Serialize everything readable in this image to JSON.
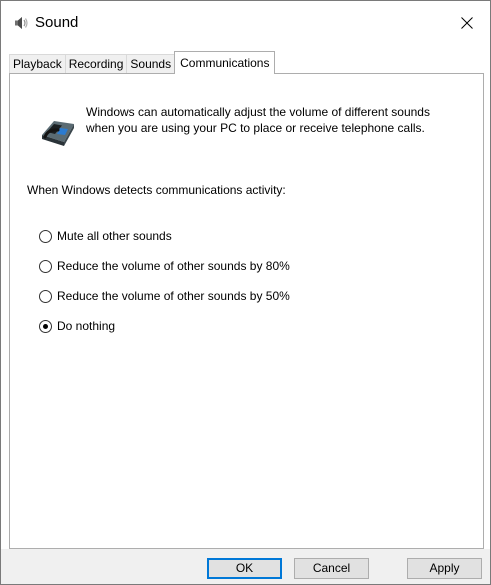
{
  "window": {
    "title": "Sound",
    "icons": {
      "app": "speaker-icon",
      "close": "close-icon"
    }
  },
  "tabs": [
    {
      "label": "Playback",
      "active": false
    },
    {
      "label": "Recording",
      "active": false
    },
    {
      "label": "Sounds",
      "active": false
    },
    {
      "label": "Communications",
      "active": true
    }
  ],
  "communications": {
    "intro_icon": "telephone-icon",
    "intro_text": "Windows can automatically adjust the volume of different sounds\nwhen you are using your PC to place or receive telephone calls.",
    "section_label": "When Windows detects communications activity:",
    "options": [
      {
        "label": "Mute all other sounds",
        "selected": false
      },
      {
        "label": "Reduce the volume of other sounds by 80%",
        "selected": false
      },
      {
        "label": "Reduce the volume of other sounds by 50%",
        "selected": false
      },
      {
        "label": "Do nothing",
        "selected": true
      }
    ]
  },
  "buttons": {
    "ok": "OK",
    "cancel": "Cancel",
    "apply": "Apply"
  },
  "colors": {
    "accent": "#0078d7",
    "button_face": "#e1e1e1",
    "footer_bg": "#f0f0f0"
  }
}
